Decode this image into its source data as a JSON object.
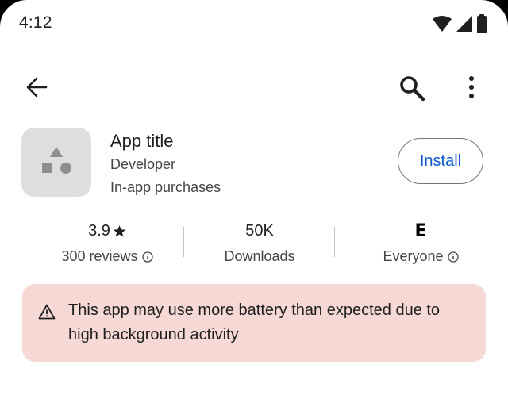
{
  "status_bar": {
    "time": "4:12",
    "icons": [
      "wifi-icon",
      "cellular-signal-icon",
      "battery-icon"
    ]
  },
  "top_bar": {
    "icons": [
      "arrow-back-icon",
      "search-icon",
      "more-vert-icon"
    ]
  },
  "app": {
    "title": "App title",
    "developer": "Developer",
    "in_app_purchases": "In-app purchases",
    "install_label": "Install",
    "icon": "shapes-placeholder-icon"
  },
  "stats": {
    "rating_value": "3.9",
    "rating_label": "300 reviews",
    "downloads_value": "50K",
    "downloads_label": "Downloads",
    "content_rating_symbol": "E",
    "content_rating_label": "Everyone"
  },
  "warning": {
    "icon": "warning-icon",
    "text": "This app may use more battery than expected due to high background activity"
  },
  "colors": {
    "accent": "#0b57d0",
    "warning_background": "#f6d8d5",
    "app_icon_background": "#dedede",
    "text_primary": "#1f1f1f",
    "text_secondary": "#444746"
  }
}
